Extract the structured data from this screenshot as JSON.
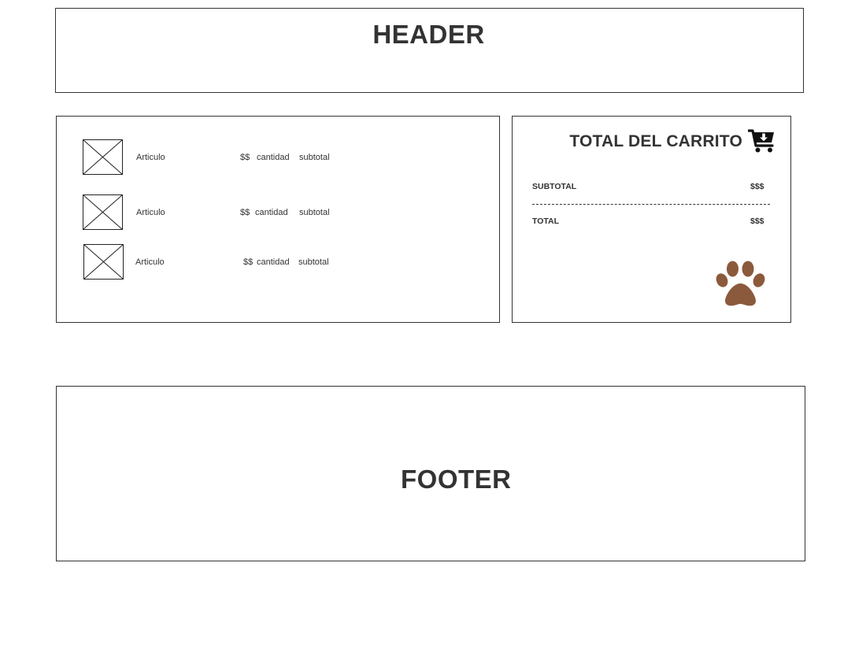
{
  "header": {
    "title": "HEADER"
  },
  "cart": {
    "items": [
      {
        "image": "image-placeholder",
        "name": "Articulo",
        "price": "$$",
        "quantity": "cantidad",
        "subtotal": "subtotal"
      },
      {
        "image": "image-placeholder",
        "name": "Articulo",
        "price": "$$",
        "quantity": "cantidad",
        "subtotal": "subtotal"
      },
      {
        "image": "image-placeholder",
        "name": "Articulo",
        "price": "$$",
        "quantity": "cantidad",
        "subtotal": "subtotal"
      }
    ]
  },
  "summary": {
    "title": "TOTAL DEL CARRITO",
    "title_icon": "cart-download-icon",
    "subtotal_label": "SUBTOTAL",
    "subtotal_value": "$$$",
    "divider": "----------------------------------------------------------------------------",
    "total_label": "TOTAL",
    "total_value": "$$$",
    "brand_icon": "paw-icon",
    "brand_color": "#8B5A3C"
  },
  "footer": {
    "title": "FOOTER"
  },
  "colors": {
    "text": "#333333",
    "border": "#333333",
    "background": "#ffffff"
  }
}
